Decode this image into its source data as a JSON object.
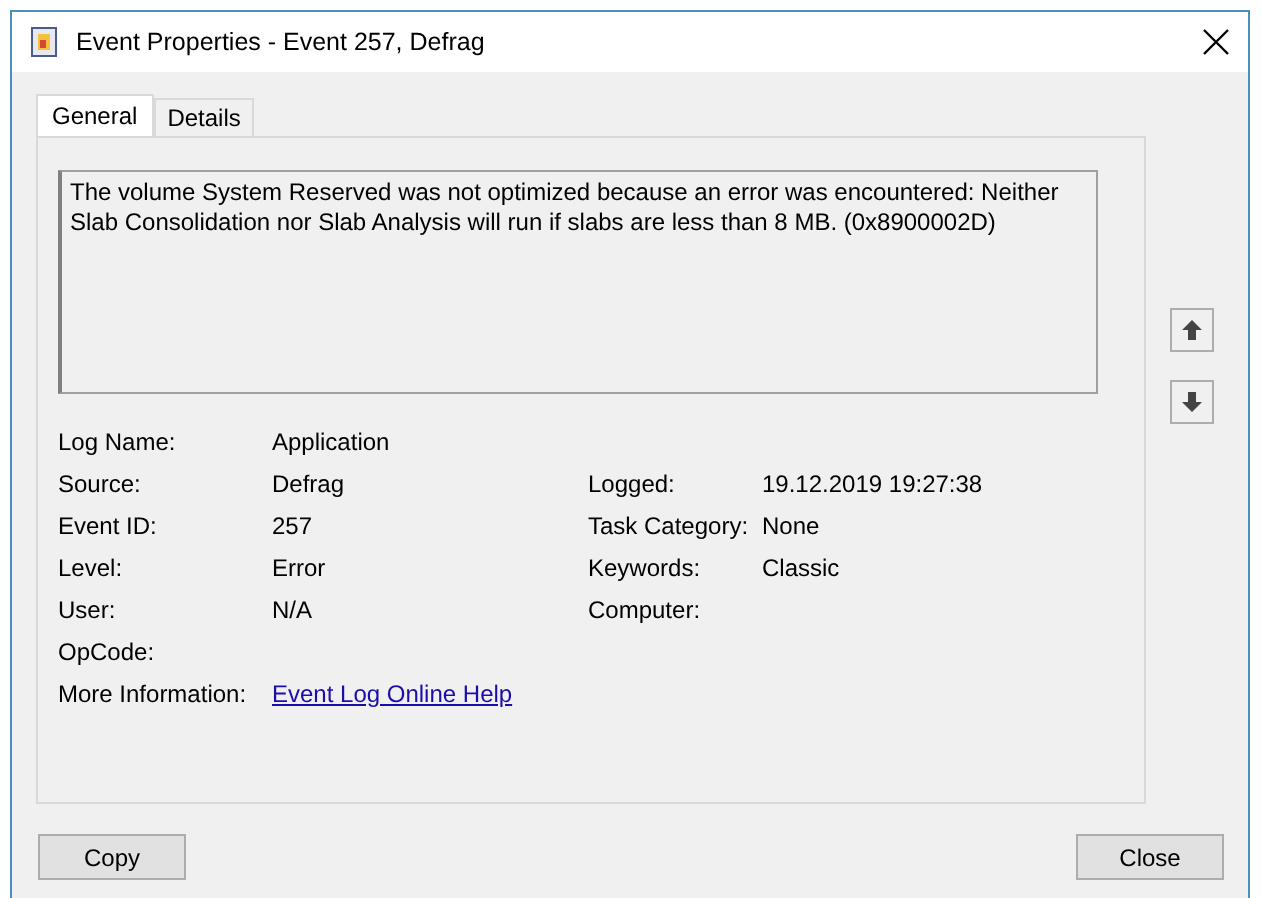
{
  "window": {
    "title": "Event Properties - Event 257, Defrag"
  },
  "tabs": [
    {
      "label": "General",
      "selected": true
    },
    {
      "label": "Details",
      "selected": false
    }
  ],
  "message": "The volume System Reserved was not optimized because an error was encountered: Neither Slab Consolidation nor Slab Analysis will run if slabs are less than 8 MB. (0x8900002D)",
  "fields": [
    {
      "label": "Log Name:",
      "value": "Application"
    },
    {
      "label": "Source:",
      "value": "Defrag",
      "right_label": "Logged:",
      "right_value": "19.12.2019 19:27:38"
    },
    {
      "label": "Event ID:",
      "value": "257",
      "right_label": "Task Category:",
      "right_value": "None"
    },
    {
      "label": "Level:",
      "value": "Error",
      "right_label": "Keywords:",
      "right_value": "Classic"
    },
    {
      "label": "User:",
      "value": "N/A",
      "right_label": "Computer:"
    },
    {
      "label": "OpCode:"
    },
    {
      "label": "More Information:",
      "link": "Event Log Online Help"
    }
  ],
  "buttons": [
    {
      "label": "Copy"
    },
    {
      "label": "Close"
    }
  ]
}
